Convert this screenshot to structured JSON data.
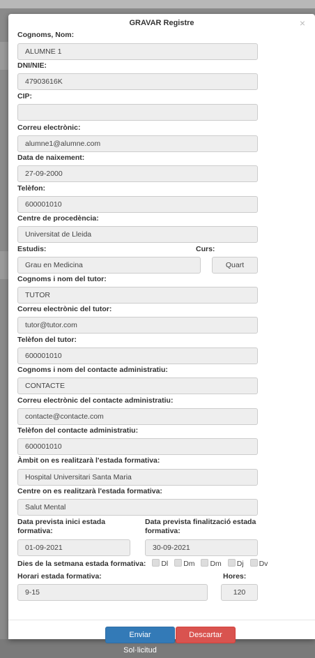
{
  "modal": {
    "title": "GRAVAR Registre",
    "close_glyph": "×"
  },
  "fields": {
    "name": {
      "label": "Cognoms, Nom:",
      "value": "ALUMNE 1"
    },
    "dni": {
      "label": "DNI/NIE:",
      "value": "47903616K"
    },
    "cip": {
      "label": "CIP:",
      "value": ""
    },
    "email": {
      "label": "Correu electrònic:",
      "value": "alumne1@alumne.com"
    },
    "birth": {
      "label": "Data de naixement:",
      "value": "27-09-2000"
    },
    "phone": {
      "label": "Telèfon:",
      "value": "600001010"
    },
    "origin_center": {
      "label": "Centre de procedència:",
      "value": "Universitat de Lleida"
    },
    "studies": {
      "label": "Estudis:",
      "value": "Grau en Medicina"
    },
    "course": {
      "label": "Curs:",
      "value": "Quart"
    },
    "tutor_name": {
      "label": "Cognoms i nom del tutor:",
      "value": "TUTOR"
    },
    "tutor_email": {
      "label": "Correu electrònic del tutor:",
      "value": "tutor@tutor.com"
    },
    "tutor_phone": {
      "label": "Telèfon del tutor:",
      "value": "600001010"
    },
    "admin_name": {
      "label": "Cognoms i nom del contacte administratiu:",
      "value": "CONTACTE"
    },
    "admin_email": {
      "label": "Correu electrònic del contacte administratiu:",
      "value": "contacte@contacte.com"
    },
    "admin_phone": {
      "label": "Telèfon del contacte administratiu:",
      "value": "600001010"
    },
    "area": {
      "label": "Àmbit on es realitzarà l'estada formativa:",
      "value": "Hospital Universitari Santa Maria"
    },
    "center": {
      "label": "Centre on es realitzarà l'estada formativa:",
      "value": "Salut Mental"
    },
    "start_date": {
      "label": "Data prevista inici estada formativa:",
      "value": "01-09-2021"
    },
    "end_date": {
      "label": "Data prevista finalització estada formativa:",
      "value": "30-09-2021"
    },
    "weekdays": {
      "label": "Dies de la setmana estada formativa:",
      "days": [
        "Dl",
        "Dm",
        "Dm",
        "Dj",
        "Dv"
      ]
    },
    "schedule": {
      "label": "Horari estada formativa:",
      "value": "9-15"
    },
    "hours": {
      "label": "Hores:",
      "value": "120"
    }
  },
  "buttons": {
    "send": "Enviar Sol·licitud",
    "discard": "Descartar"
  },
  "colors": {
    "primary": "#337ab7",
    "danger": "#d9534f",
    "input_bg": "#eeeeee"
  }
}
